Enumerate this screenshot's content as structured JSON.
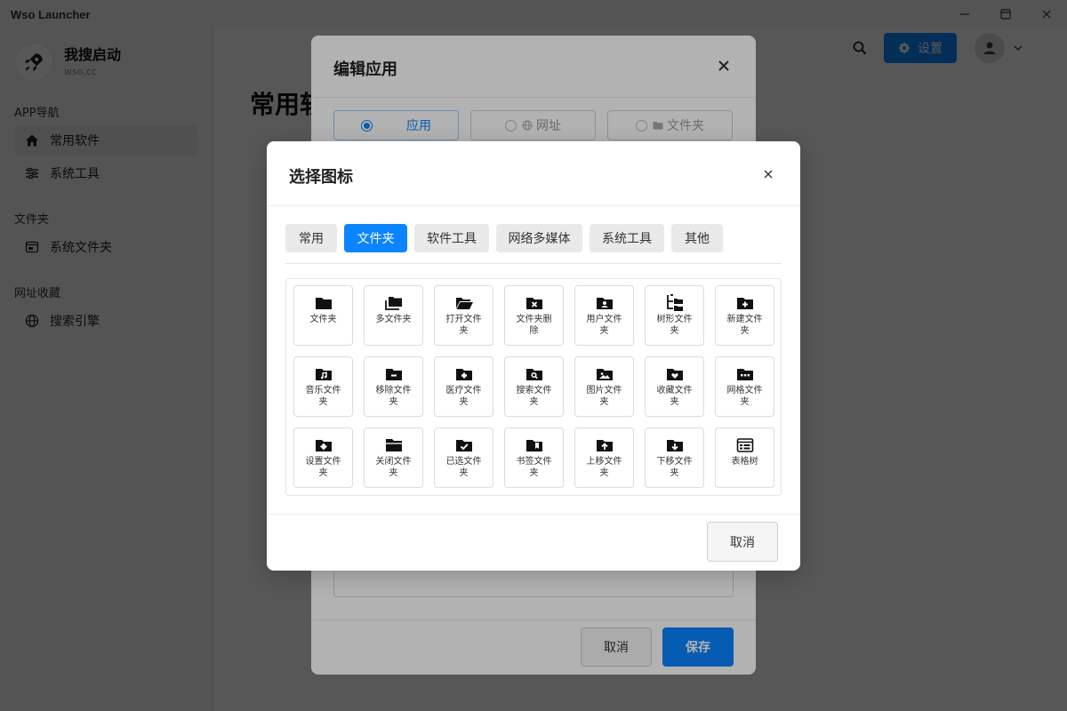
{
  "window": {
    "title": "Wso Launcher"
  },
  "brand": {
    "name": "我搜启动",
    "subtitle": "wso.cc"
  },
  "sidebar": {
    "sections": [
      {
        "title": "APP导航",
        "items": [
          {
            "label": "常用软件",
            "icon": "home-icon",
            "active": true
          },
          {
            "label": "系统工具",
            "icon": "sliders-icon",
            "active": false
          }
        ]
      },
      {
        "title": "文件夹",
        "items": [
          {
            "label": "系统文件夹",
            "icon": "window-icon",
            "active": false
          }
        ]
      },
      {
        "title": "网址收藏",
        "items": [
          {
            "label": "搜索引擎",
            "icon": "globe-icon",
            "active": false
          }
        ]
      }
    ]
  },
  "topbar": {
    "settings_label": "设置"
  },
  "page": {
    "title": "常用软件"
  },
  "edit_dialog": {
    "title": "编辑应用",
    "types": [
      {
        "label": "应用",
        "selected": true
      },
      {
        "label": "网址",
        "selected": false
      },
      {
        "label": "文件夹",
        "selected": false
      }
    ],
    "cancel_label": "取消",
    "save_label": "保存"
  },
  "icon_dialog": {
    "title": "选择图标",
    "categories": [
      "常用",
      "文件夹",
      "软件工具",
      "网络多媒体",
      "系统工具",
      "其他"
    ],
    "active_category": "文件夹",
    "icons": [
      {
        "label": "文件夹",
        "icon": "folder-icon"
      },
      {
        "label": "多文件夹",
        "icon": "folders-icon"
      },
      {
        "label": "打开文件夹",
        "icon": "folder-open-icon"
      },
      {
        "label": "文件夹删除",
        "icon": "folder-delete-icon"
      },
      {
        "label": "用户文件夹",
        "icon": "folder-user-icon"
      },
      {
        "label": "树形文件夹",
        "icon": "folder-tree-icon"
      },
      {
        "label": "新建文件夹",
        "icon": "folder-plus-icon"
      },
      {
        "label": "音乐文件夹",
        "icon": "folder-music-icon"
      },
      {
        "label": "移除文件夹",
        "icon": "folder-minus-icon"
      },
      {
        "label": "医疗文件夹",
        "icon": "folder-medical-icon"
      },
      {
        "label": "搜索文件夹",
        "icon": "folder-search-icon"
      },
      {
        "label": "图片文件夹",
        "icon": "folder-image-icon"
      },
      {
        "label": "收藏文件夹",
        "icon": "folder-heart-icon"
      },
      {
        "label": "网格文件夹",
        "icon": "folder-grid-icon"
      },
      {
        "label": "设置文件夹",
        "icon": "folder-cog-icon"
      },
      {
        "label": "关闭文件夹",
        "icon": "folder-closed-icon"
      },
      {
        "label": "已选文件夹",
        "icon": "folder-check-icon"
      },
      {
        "label": "书签文件夹",
        "icon": "folder-bookmark-icon"
      },
      {
        "label": "上移文件夹",
        "icon": "folder-up-icon"
      },
      {
        "label": "下移文件夹",
        "icon": "folder-down-icon"
      },
      {
        "label": "表格树",
        "icon": "table-tree-icon"
      }
    ],
    "cancel_label": "取消"
  }
}
